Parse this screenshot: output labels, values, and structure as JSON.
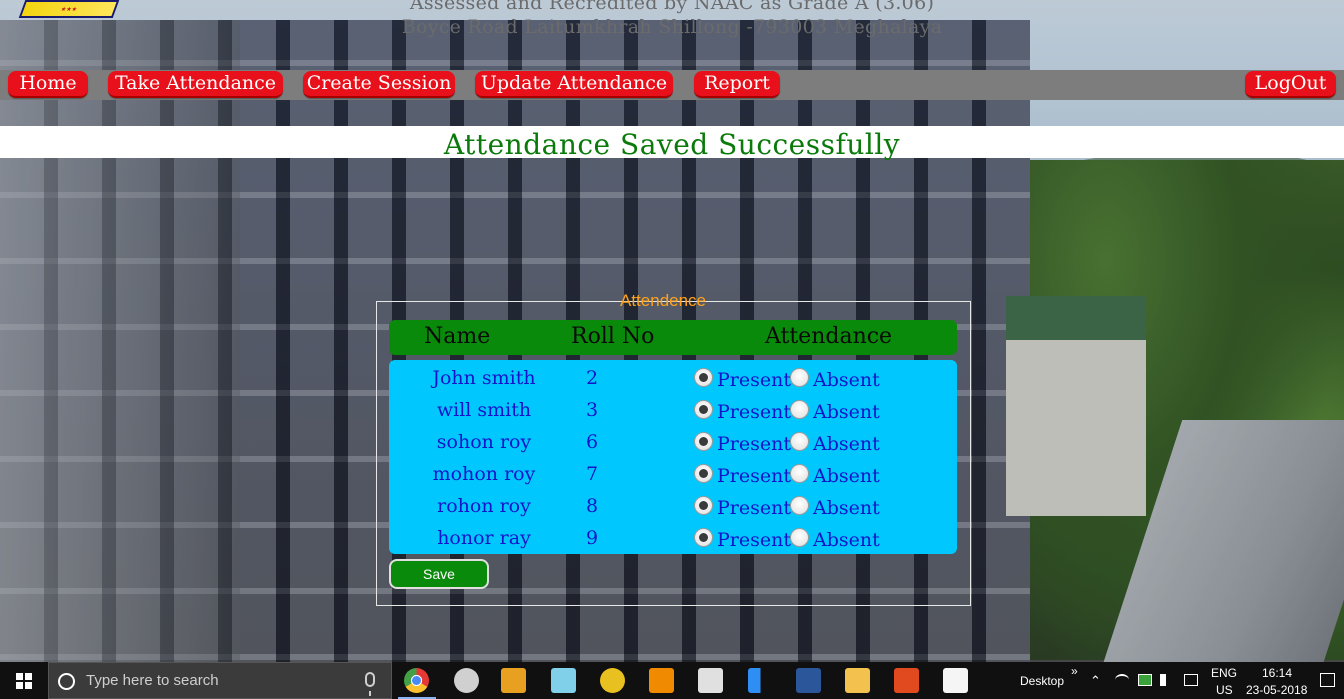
{
  "header": {
    "accreditation": "Assessed and Recredited by NAAC as Grade A (3.06)",
    "address": "Boyce Road Laitumkhrah Shillong -793003 Meghalaya"
  },
  "nav": {
    "home": "Home",
    "take_attendance": "Take Attendance",
    "create_session": "Create Session",
    "update_attendance": "Update Attendance",
    "report": "Report",
    "logout": "LogOut"
  },
  "message": "Attendance Saved Successfully",
  "form": {
    "legend": "Attendence",
    "headers": {
      "name": "Name",
      "roll": "Roll No",
      "attendance": "Attendance"
    },
    "present_label": "Present",
    "absent_label": "Absent",
    "rows": [
      {
        "name": "John smith",
        "roll": "2",
        "status": "Present"
      },
      {
        "name": "will smith",
        "roll": "3",
        "status": "Present"
      },
      {
        "name": "sohon roy",
        "roll": "6",
        "status": "Present"
      },
      {
        "name": "mohon roy",
        "roll": "7",
        "status": "Present"
      },
      {
        "name": "rohon roy",
        "roll": "8",
        "status": "Present"
      },
      {
        "name": "honor ray",
        "roll": "9",
        "status": "Present"
      }
    ],
    "save_label": "Save"
  },
  "taskbar": {
    "search_placeholder": "Type here to search",
    "desktop_label": "Desktop",
    "language": "ENG",
    "region": "US",
    "time": "16:14",
    "date": "23-05-2018"
  },
  "colors": {
    "nav_button": "#e8101a",
    "message": "#0a7a0a",
    "table_header": "#0a8a0a",
    "table_body": "#00c8ff",
    "row_text": "#1414c8",
    "legend": "#ffa21a"
  }
}
